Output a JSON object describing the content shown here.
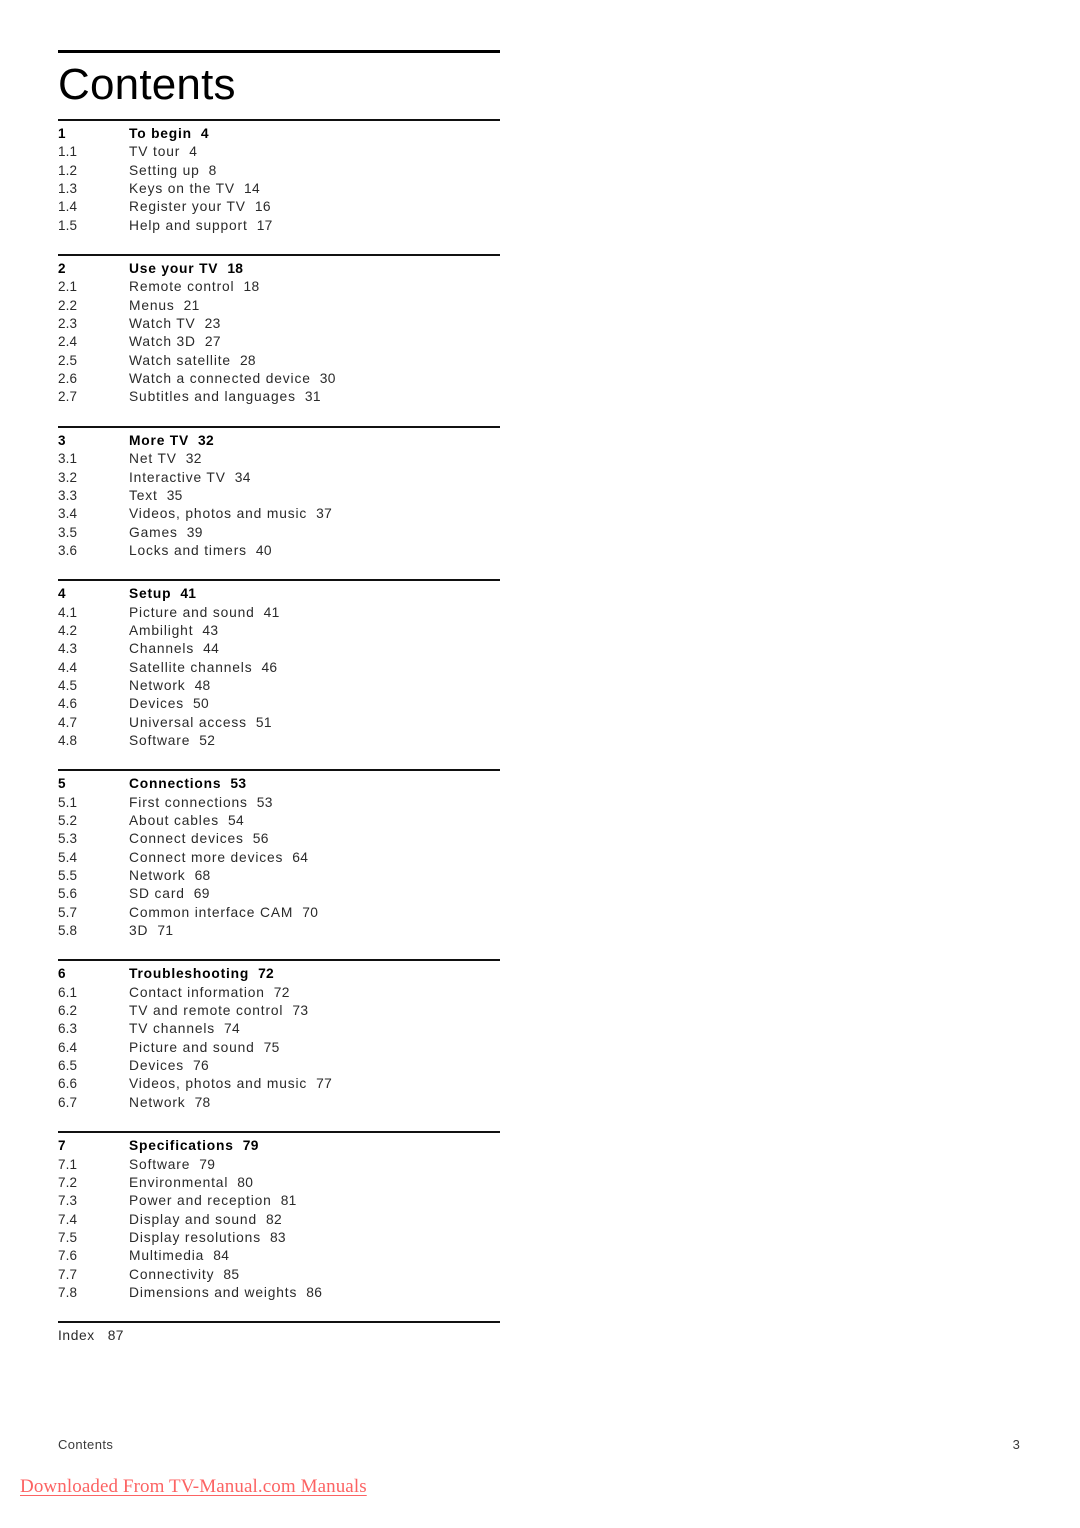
{
  "document": {
    "title": "Contents",
    "footer_left": "Contents",
    "footer_page": "3",
    "watermark": "Downloaded From TV-Manual.com Manuals",
    "watermark_color": "#fc6363"
  },
  "toc": {
    "sections": [
      {
        "head": {
          "num": "1",
          "label": "To begin",
          "page": "4"
        },
        "entries": [
          {
            "num": "1.1",
            "label": "TV tour",
            "page": "4"
          },
          {
            "num": "1.2",
            "label": "Setting up",
            "page": "8"
          },
          {
            "num": "1.3",
            "label": "Keys on the TV",
            "page": "14"
          },
          {
            "num": "1.4",
            "label": "Register your TV",
            "page": "16"
          },
          {
            "num": "1.5",
            "label": "Help and support",
            "page": "17"
          }
        ]
      },
      {
        "head": {
          "num": "2",
          "label": "Use your TV",
          "page": "18"
        },
        "entries": [
          {
            "num": "2.1",
            "label": "Remote control",
            "page": "18"
          },
          {
            "num": "2.2",
            "label": "Menus",
            "page": "21"
          },
          {
            "num": "2.3",
            "label": "Watch TV",
            "page": "23"
          },
          {
            "num": "2.4",
            "label": "Watch 3D",
            "page": "27"
          },
          {
            "num": "2.5",
            "label": "Watch satellite",
            "page": "28"
          },
          {
            "num": "2.6",
            "label": "Watch a connected device",
            "page": "30"
          },
          {
            "num": "2.7",
            "label": "Subtitles and languages",
            "page": "31"
          }
        ]
      },
      {
        "head": {
          "num": "3",
          "label": "More TV",
          "page": "32"
        },
        "entries": [
          {
            "num": "3.1",
            "label": "Net TV",
            "page": "32"
          },
          {
            "num": "3.2",
            "label": "Interactive TV",
            "page": "34"
          },
          {
            "num": "3.3",
            "label": "Text",
            "page": "35"
          },
          {
            "num": "3.4",
            "label": "Videos, photos and music",
            "page": "37"
          },
          {
            "num": "3.5",
            "label": "Games",
            "page": "39"
          },
          {
            "num": "3.6",
            "label": "Locks and timers",
            "page": "40"
          }
        ]
      },
      {
        "head": {
          "num": "4",
          "label": "Setup",
          "page": "41"
        },
        "entries": [
          {
            "num": "4.1",
            "label": "Picture and sound",
            "page": "41"
          },
          {
            "num": "4.2",
            "label": "Ambilight",
            "page": "43"
          },
          {
            "num": "4.3",
            "label": "Channels",
            "page": "44"
          },
          {
            "num": "4.4",
            "label": "Satellite channels",
            "page": "46"
          },
          {
            "num": "4.5",
            "label": "Network",
            "page": "48"
          },
          {
            "num": "4.6",
            "label": "Devices",
            "page": "50"
          },
          {
            "num": "4.7",
            "label": "Universal access",
            "page": "51"
          },
          {
            "num": "4.8",
            "label": "Software",
            "page": "52"
          }
        ]
      },
      {
        "head": {
          "num": "5",
          "label": "Connections",
          "page": "53"
        },
        "entries": [
          {
            "num": "5.1",
            "label": "First connections",
            "page": "53"
          },
          {
            "num": "5.2",
            "label": "About cables",
            "page": "54"
          },
          {
            "num": "5.3",
            "label": "Connect devices",
            "page": "56"
          },
          {
            "num": "5.4",
            "label": "Connect more devices",
            "page": "64"
          },
          {
            "num": "5.5",
            "label": "Network",
            "page": "68"
          },
          {
            "num": "5.6",
            "label": "SD card",
            "page": "69"
          },
          {
            "num": "5.7",
            "label": "Common interface CAM",
            "page": "70"
          },
          {
            "num": "5.8",
            "label": "3D",
            "page": "71"
          }
        ]
      },
      {
        "head": {
          "num": "6",
          "label": "Troubleshooting",
          "page": "72"
        },
        "entries": [
          {
            "num": "6.1",
            "label": "Contact information",
            "page": "72"
          },
          {
            "num": "6.2",
            "label": "TV and remote control",
            "page": "73"
          },
          {
            "num": "6.3",
            "label": "TV channels",
            "page": "74"
          },
          {
            "num": "6.4",
            "label": "Picture and sound",
            "page": "75"
          },
          {
            "num": "6.5",
            "label": "Devices",
            "page": "76"
          },
          {
            "num": "6.6",
            "label": "Videos, photos and music",
            "page": "77"
          },
          {
            "num": "6.7",
            "label": "Network",
            "page": "78"
          }
        ]
      },
      {
        "head": {
          "num": "7",
          "label": "Specifications",
          "page": "79"
        },
        "entries": [
          {
            "num": "7.1",
            "label": "Software",
            "page": "79"
          },
          {
            "num": "7.2",
            "label": "Environmental",
            "page": "80"
          },
          {
            "num": "7.3",
            "label": "Power and reception",
            "page": "81"
          },
          {
            "num": "7.4",
            "label": "Display and sound",
            "page": "82"
          },
          {
            "num": "7.5",
            "label": "Display resolutions",
            "page": "83"
          },
          {
            "num": "7.6",
            "label": "Multimedia",
            "page": "84"
          },
          {
            "num": "7.7",
            "label": "Connectivity",
            "page": "85"
          },
          {
            "num": "7.8",
            "label": "Dimensions and weights",
            "page": "86"
          }
        ]
      }
    ],
    "index": {
      "label": "Index",
      "page": "87"
    }
  }
}
